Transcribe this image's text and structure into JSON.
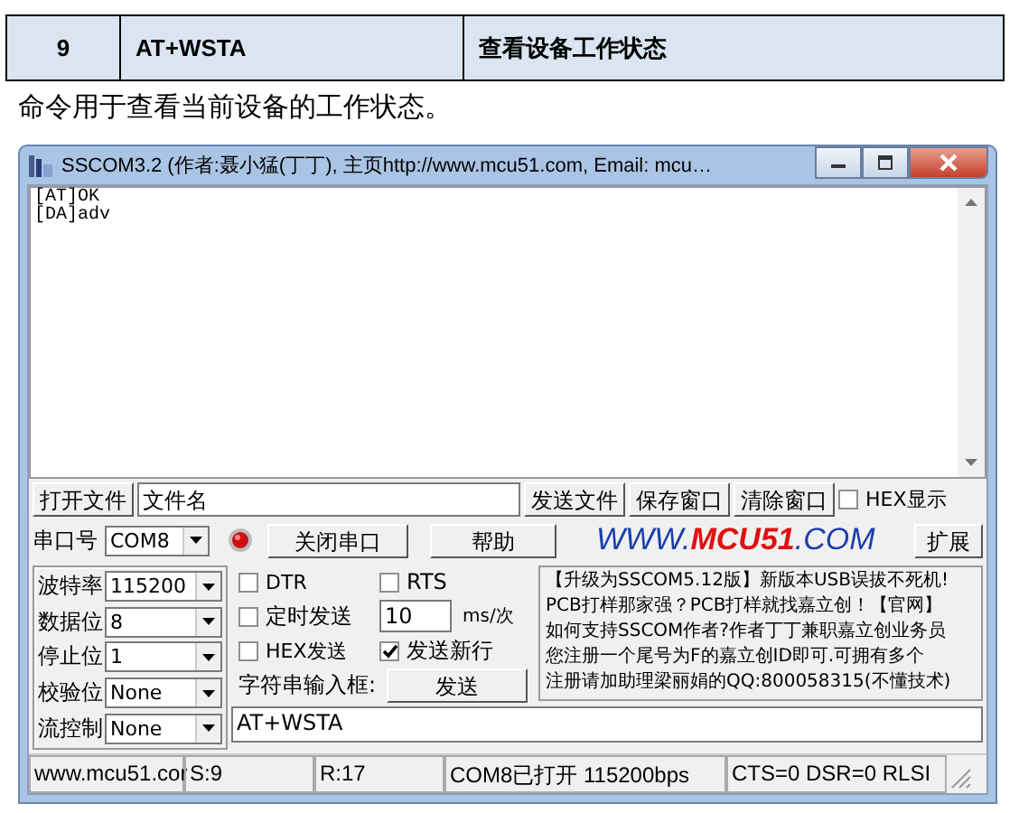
{
  "table_row": {
    "cells": [
      "9",
      "AT+WSTA",
      "查看设备工作状态"
    ]
  },
  "description": "命令用于查看当前设备的工作状态。",
  "window": {
    "title": "SSCOM3.2 (作者:聂小猛(丁丁), 主页http://www.mcu51.com,  Email: mcu…",
    "receive_lines": [
      "[AT]OK",
      "[DA]adv"
    ],
    "file_row": {
      "open_button": "打开文件",
      "file_field": {
        "value": "文件名"
      },
      "buttons": [
        "发送文件",
        "保存窗口",
        "清除窗口"
      ],
      "hex_display": {
        "label": "HEX显示",
        "checked": false
      }
    },
    "port_row": {
      "label": "串口号",
      "port": "COM8",
      "lamp_on": true,
      "toggle_button": "关闭串口",
      "help_button": "帮助",
      "logo": {
        "prefix": "WWW.",
        "brand": "MCU51",
        "suffix": ".COM"
      },
      "expand_button": "扩展"
    },
    "settings": [
      {
        "label": "波特率",
        "value": "115200"
      },
      {
        "label": "数据位",
        "value": "8"
      },
      {
        "label": "停止位",
        "value": "1"
      },
      {
        "label": "校验位",
        "value": "None"
      },
      {
        "label": "流控制",
        "value": "None"
      }
    ],
    "dtr": {
      "label": "DTR",
      "checked": false
    },
    "rts": {
      "label": "RTS",
      "checked": false
    },
    "timed_send": {
      "label": "定时发送",
      "checked": false
    },
    "interval": {
      "value": "10",
      "unit": "ms/次"
    },
    "hex_send": {
      "label": "HEX发送",
      "checked": false
    },
    "send_newline": {
      "label": "发送新行",
      "checked": true
    },
    "input_label": "字符串输入框:",
    "send_button": "发送",
    "input": {
      "value": "AT+WSTA"
    },
    "ad_lines": [
      "【升级为SSCOM5.12版】新版本USB误拔不死机!",
      "PCB打样那家强？PCB打样就找嘉立创！【官网】",
      "如何支持SSCOM作者?作者丁丁兼职嘉立创业务员",
      "您注册一个尾号为F的嘉立创ID即可.可拥有多个",
      "注册请加助理梁丽娟的QQ:800058315(不懂技术)"
    ],
    "status_bar": [
      "www.mcu51.cor",
      "S:9",
      "R:17",
      "COM8已打开  115200bps",
      "CTS=0 DSR=0 RLSI"
    ]
  }
}
